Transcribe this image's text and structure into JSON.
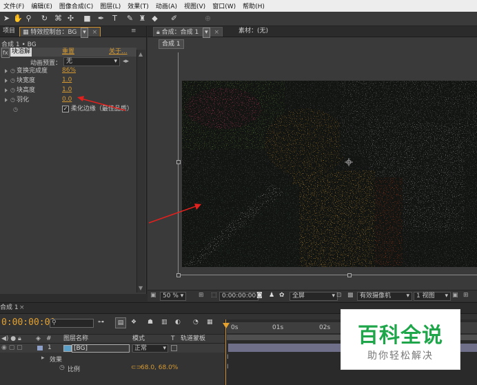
{
  "menubar": {
    "items": [
      "文件(F)",
      "编辑(E)",
      "图像合成(C)",
      "图层(L)",
      "效果(T)",
      "动画(A)",
      "视图(V)",
      "窗口(W)",
      "帮助(H)"
    ]
  },
  "toolbar": {
    "icons": [
      "selection-tool",
      "hand-tool",
      "zoom-tool",
      "rotate-tool",
      "camera-orbit-tool",
      "pan-behind-tool",
      "rectangle-tool",
      "pen-tool",
      "text-tool",
      "brush-tool",
      "clone-stamp-tool",
      "eraser-tool",
      "puppet-tool"
    ]
  },
  "left_panel": {
    "tab_project": "项目",
    "tab_effect_controls": "特效控制台：BG",
    "panel_menu": "≡",
    "breadcrumb": "合成 1 • BG",
    "effect": {
      "fx": "fx",
      "name": "块溶解",
      "reset": "重置",
      "about": "关于...",
      "preset_label": "动画预置：",
      "preset_value": "无",
      "properties": [
        {
          "label": "变换完成度",
          "value": "86%"
        },
        {
          "label": "块宽度",
          "value": "1.0"
        },
        {
          "label": "块高度",
          "value": "1.0"
        },
        {
          "label": "羽化",
          "value": "0.0"
        }
      ],
      "soften_checkbox": "✓",
      "soften_label": "柔化边缘（最佳品质）"
    }
  },
  "viewer": {
    "tab_comp": "合成：合成 1",
    "tab_footage": "素材：(无)",
    "comp_button": "合成 1",
    "zoom": "50 %",
    "timecode": "0:00:00:00",
    "resolution": "全屏",
    "camera": "有效摄像机",
    "views": "1 视图"
  },
  "timeline": {
    "tab": "合成 1",
    "timecode": "0:00:00:00",
    "search_placeholder": "",
    "col_num": "#",
    "col_source": "图层名称",
    "col_mode": "模式",
    "col_t": "T",
    "col_trkmat": "轨道蒙板",
    "ruler_ticks": [
      "0s",
      "01s",
      "02s"
    ],
    "layer": {
      "index": "1",
      "name": "[BG]",
      "mode": "正常"
    },
    "effects_label": "效果",
    "scale_label": "比例",
    "scale_value": "68.0, 68.0%"
  },
  "watermark": {
    "title": "百科全说",
    "subtitle": "助你轻松解决"
  },
  "colors": {
    "accent_orange": "#d79b32",
    "annotation_red": "#e0211d",
    "watermark_green": "#1fa64a"
  }
}
